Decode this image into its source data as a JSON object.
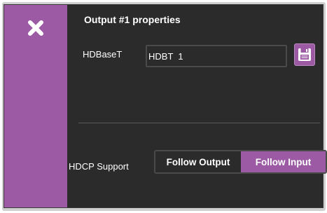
{
  "panel": {
    "title": "Output #1 properties",
    "accent_color": "#9b5aa3"
  },
  "close": {
    "icon": "close-icon"
  },
  "hdbaset": {
    "label": "HDBaseT",
    "value": "HDBT  1",
    "save_icon": "floppy-disk-icon"
  },
  "hdcp": {
    "label": "HDCP Support",
    "options": [
      "Follow Output",
      "Follow Input"
    ],
    "selected": "Follow Input"
  }
}
